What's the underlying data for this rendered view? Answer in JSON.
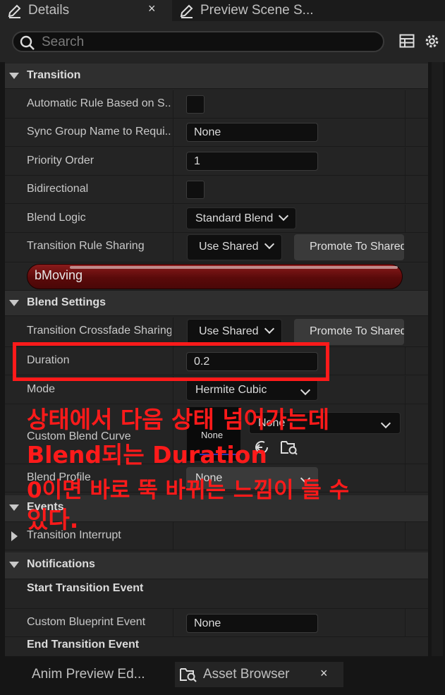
{
  "tabs": [
    {
      "label": "Details",
      "icon": "pencil-icon",
      "close": "×"
    },
    {
      "label": "Preview Scene S...",
      "icon": "pencil-icon"
    }
  ],
  "search": {
    "placeholder": "Search"
  },
  "categories": {
    "transition": "Transition",
    "blend_settings": "Blend Settings",
    "events": "Events",
    "notifications": "Notifications"
  },
  "transition": {
    "automatic_rule_label": "Automatic Rule Based on S...",
    "sync_group_label": "Sync Group Name to Requi...",
    "sync_group_value": "None",
    "priority_label": "Priority Order",
    "priority_value": "1",
    "bidirectional_label": "Bidirectional",
    "blend_logic_label": "Blend Logic",
    "blend_logic_value": "Standard Blend",
    "rule_sharing_label": "Transition Rule Sharing",
    "rule_sharing_value": "Use Shared",
    "promote_label": "Promote To Shared",
    "rule_node": "bMoving"
  },
  "blend_settings": {
    "crossfade_label": "Transition Crossfade Sharing",
    "crossfade_value": "Use Shared",
    "promote_label": "Promote To Shared",
    "duration_label": "Duration",
    "duration_value": "0.2",
    "mode_label": "Mode",
    "mode_value": "Hermite Cubic",
    "custom_curve_label": "Custom Blend Curve",
    "custom_curve_thumb": "None",
    "custom_curve_value": "None",
    "blend_profile_label": "Blend Profile",
    "blend_profile_value": "None"
  },
  "events": {
    "interrupt_label": "Transition Interrupt"
  },
  "notifications": {
    "start_label": "Start Transition Event",
    "custom_bp_label": "Custom Blueprint Event",
    "custom_bp_value": "None",
    "end_label": "End Transition Event"
  },
  "bottom_tabs": [
    {
      "label": "Anim Preview Ed..."
    },
    {
      "label": "Asset Browser",
      "close": "×"
    }
  ],
  "annotation": {
    "color": "#ff1a1a",
    "lines": [
      "상태에서 다음 상태 넘어가는데",
      "Blend되는 Duration",
      "0이면 바로 뚝 바뀌는 느낌이 들 수",
      "있다."
    ]
  }
}
